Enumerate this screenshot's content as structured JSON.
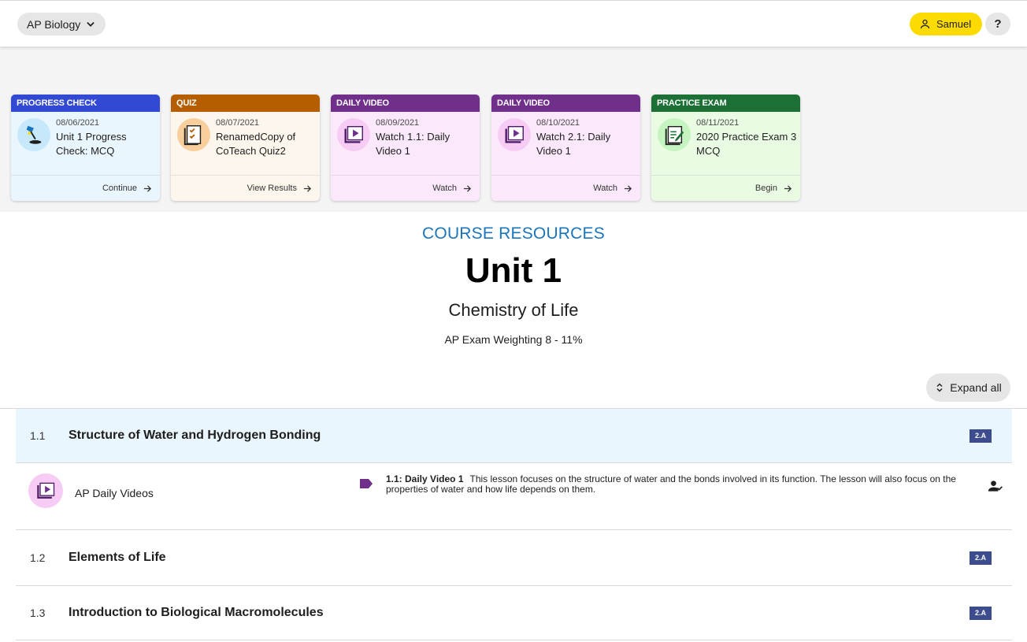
{
  "header": {
    "course": "AP Biology",
    "user": "Samuel",
    "help": "?"
  },
  "colors": {
    "progress_check": "#3249d3",
    "quiz": "#b55e00",
    "daily_video": "#702f8a",
    "practice_exam": "#1c7035",
    "user_button": "#fedb00",
    "resources_heading": "#1a75bb",
    "skill_badge": "#3c4c8e"
  },
  "cards": [
    {
      "category": "PROGRESS CHECK",
      "date": "08/06/2021",
      "title": "Unit 1 Progress Check: MCQ",
      "action": "Continue",
      "icon": "desk-lamp-icon"
    },
    {
      "category": "QUIZ",
      "date": "08/07/2021",
      "title": "RenamedCopy of CoTeach Quiz2",
      "action": "View Results",
      "icon": "checklist-icon"
    },
    {
      "category": "DAILY VIDEO",
      "date": "08/09/2021",
      "title": "Watch 1.1: Daily Video 1",
      "action": "Watch",
      "icon": "video-play-icon"
    },
    {
      "category": "DAILY VIDEO",
      "date": "08/10/2021",
      "title": "Watch 2.1: Daily Video 1",
      "action": "Watch",
      "icon": "video-play-icon"
    },
    {
      "category": "PRACTICE EXAM",
      "date": "08/11/2021",
      "title": "2020 Practice Exam 3 MCQ",
      "action": "Begin",
      "icon": "notebook-pen-icon"
    }
  ],
  "unit": {
    "section_label": "COURSE RESOURCES",
    "title": "Unit 1",
    "subtitle": "Chemistry of Life",
    "weighting": "AP Exam Weighting 8 - 11%"
  },
  "expand_all": "Expand all",
  "topics": [
    {
      "num": "1.1",
      "title": "Structure of Water and Hydrogen Bonding",
      "skill": "2.A"
    },
    {
      "num": "1.2",
      "title": "Elements of Life",
      "skill": "2.A"
    },
    {
      "num": "1.3",
      "title": "Introduction to Biological Macromolecules",
      "skill": "2.A"
    }
  ],
  "resource": {
    "label": "AP Daily Videos",
    "video_title": "1.1: Daily Video 1",
    "description": "This lesson focuses on the structure of water and the bonds involved in its function. The lesson will also focus on the properties of water and how life depends on them."
  }
}
